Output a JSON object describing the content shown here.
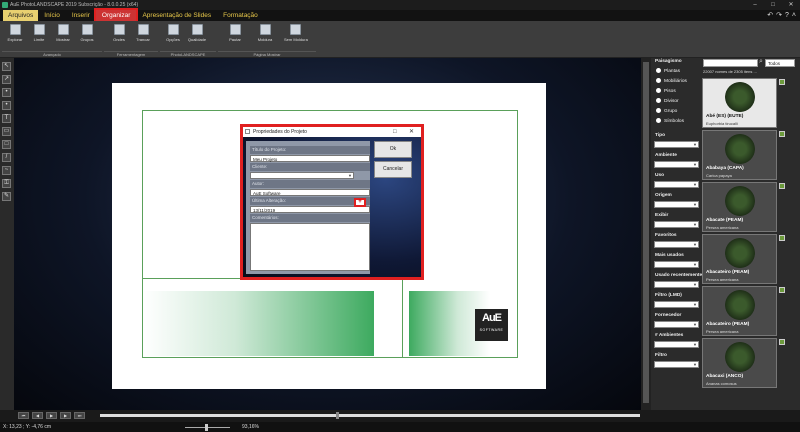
{
  "window": {
    "title": "AuE PhotoLANDSCAPE 2019 Subscrição - 8.0.0.25 (x64)"
  },
  "menu": {
    "items": [
      "Arquivos",
      "Início",
      "Inserir",
      "Organizar",
      "Apresentação de Slides",
      "Formatação"
    ],
    "active": "Organizar"
  },
  "ribbon": {
    "buttons": [
      "Explorar",
      "Limite",
      "Mostrar",
      "Grupos",
      "Ondes",
      "Trancar",
      "Opções",
      "Qualidade",
      "Pautar",
      "Moldura",
      "Sem Moldura"
    ],
    "groups": [
      "Avançado",
      "Ferramentagem",
      "PhotoLANDSCAPE",
      "Página Mostrar"
    ]
  },
  "dialog": {
    "title": "Propriedades do Projeto",
    "title_label": "Título do Projeto:",
    "title_value": "Meu Projeto",
    "client_label": "Cliente:",
    "client_value": "",
    "author_label": "Autor:",
    "author_value": "AuE Software",
    "last_change_label": "Última Alteração:",
    "last_change_value": "13/11/2019",
    "comments_label": "Comentários:",
    "ok_label": "Ok",
    "cancel_label": "Cancelar",
    "plus_label": "+"
  },
  "canvas": {
    "logo_text": "AuE",
    "logo_sub": "SOFTWARE"
  },
  "right_panel": {
    "search_placeholder": "",
    "filter_value": "Todos",
    "section_title": "Paisagismo",
    "count_text": "22007 nomes de 2305 itens ...",
    "radio_items": [
      "Plantas",
      "Mobiliários",
      "Pisos",
      "Divisor",
      "Grupo",
      "Símbolos"
    ],
    "categories": [
      "Tipo",
      "Ambiente",
      "Uso",
      "Origem",
      "Exibir",
      "Favoritos",
      "Mais usados",
      "Usado recentemente",
      "Filtro (LMD)",
      "Fornecedor",
      "# Ambientes",
      "Filtro"
    ],
    "cards": [
      {
        "name": "Abé (ES) (EUTE)",
        "sci": "Euphorbia tirucalli"
      },
      {
        "name": "Ababaya (CAPA)",
        "sci": "Carica papaya"
      },
      {
        "name": "Abacate (PEAM)",
        "sci": "Persea americana"
      },
      {
        "name": "Abacateiro (PEAM)",
        "sci": "Persea americana"
      },
      {
        "name": "Abacateiro (PEAM)",
        "sci": "Persea americana"
      },
      {
        "name": "Abacaxi (ANCO)",
        "sci": "Ananas comosus"
      }
    ]
  },
  "status": {
    "coords": "X: 13,23 ; Y: -4,76 cm",
    "zoom": "93,16%"
  }
}
